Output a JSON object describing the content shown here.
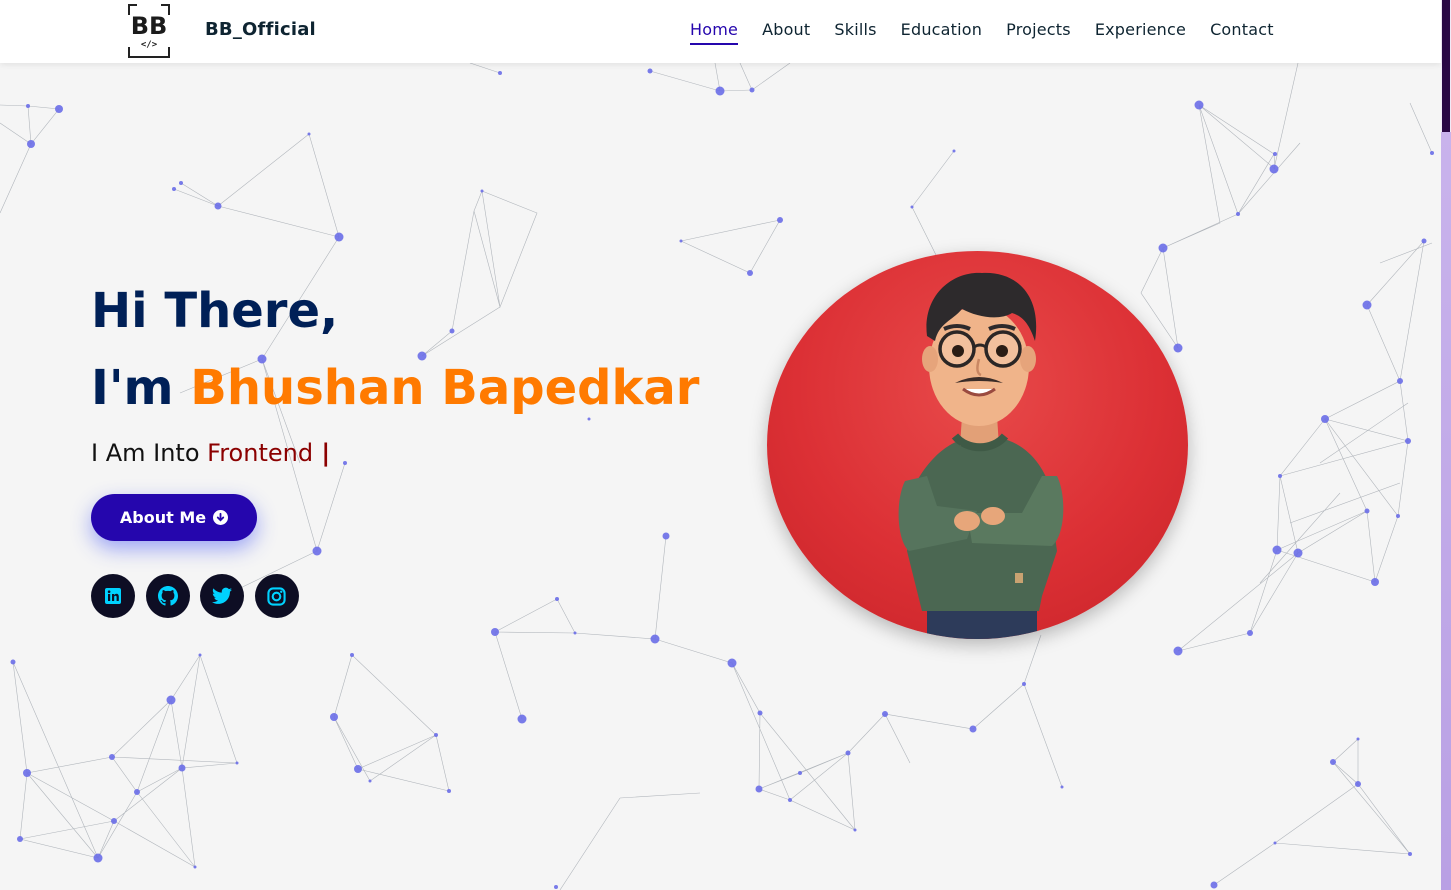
{
  "header": {
    "logo_text": "BB",
    "brand": "BB_Official",
    "nav": [
      {
        "label": "Home",
        "active": true
      },
      {
        "label": "About"
      },
      {
        "label": "Skills"
      },
      {
        "label": "Education"
      },
      {
        "label": "Projects"
      },
      {
        "label": "Experience"
      },
      {
        "label": "Contact"
      }
    ]
  },
  "hero": {
    "greeting": "Hi There,",
    "intro_prefix": "I'm ",
    "name": "Bhushan Bapedkar",
    "sub_prefix": "I Am Into ",
    "role": "Frontend",
    "cursor": " |",
    "button_label": "About Me"
  },
  "socials": [
    {
      "icon": "linkedin-icon"
    },
    {
      "icon": "github-icon"
    },
    {
      "icon": "twitter-icon"
    },
    {
      "icon": "instagram-icon"
    }
  ],
  "colors": {
    "primary": "#2506ad",
    "title": "#002057",
    "name_accent": "#ff7a00",
    "role_accent": "#8b0000",
    "avatar_bg": "#dc3035",
    "social_icon": "#00d2ff"
  }
}
